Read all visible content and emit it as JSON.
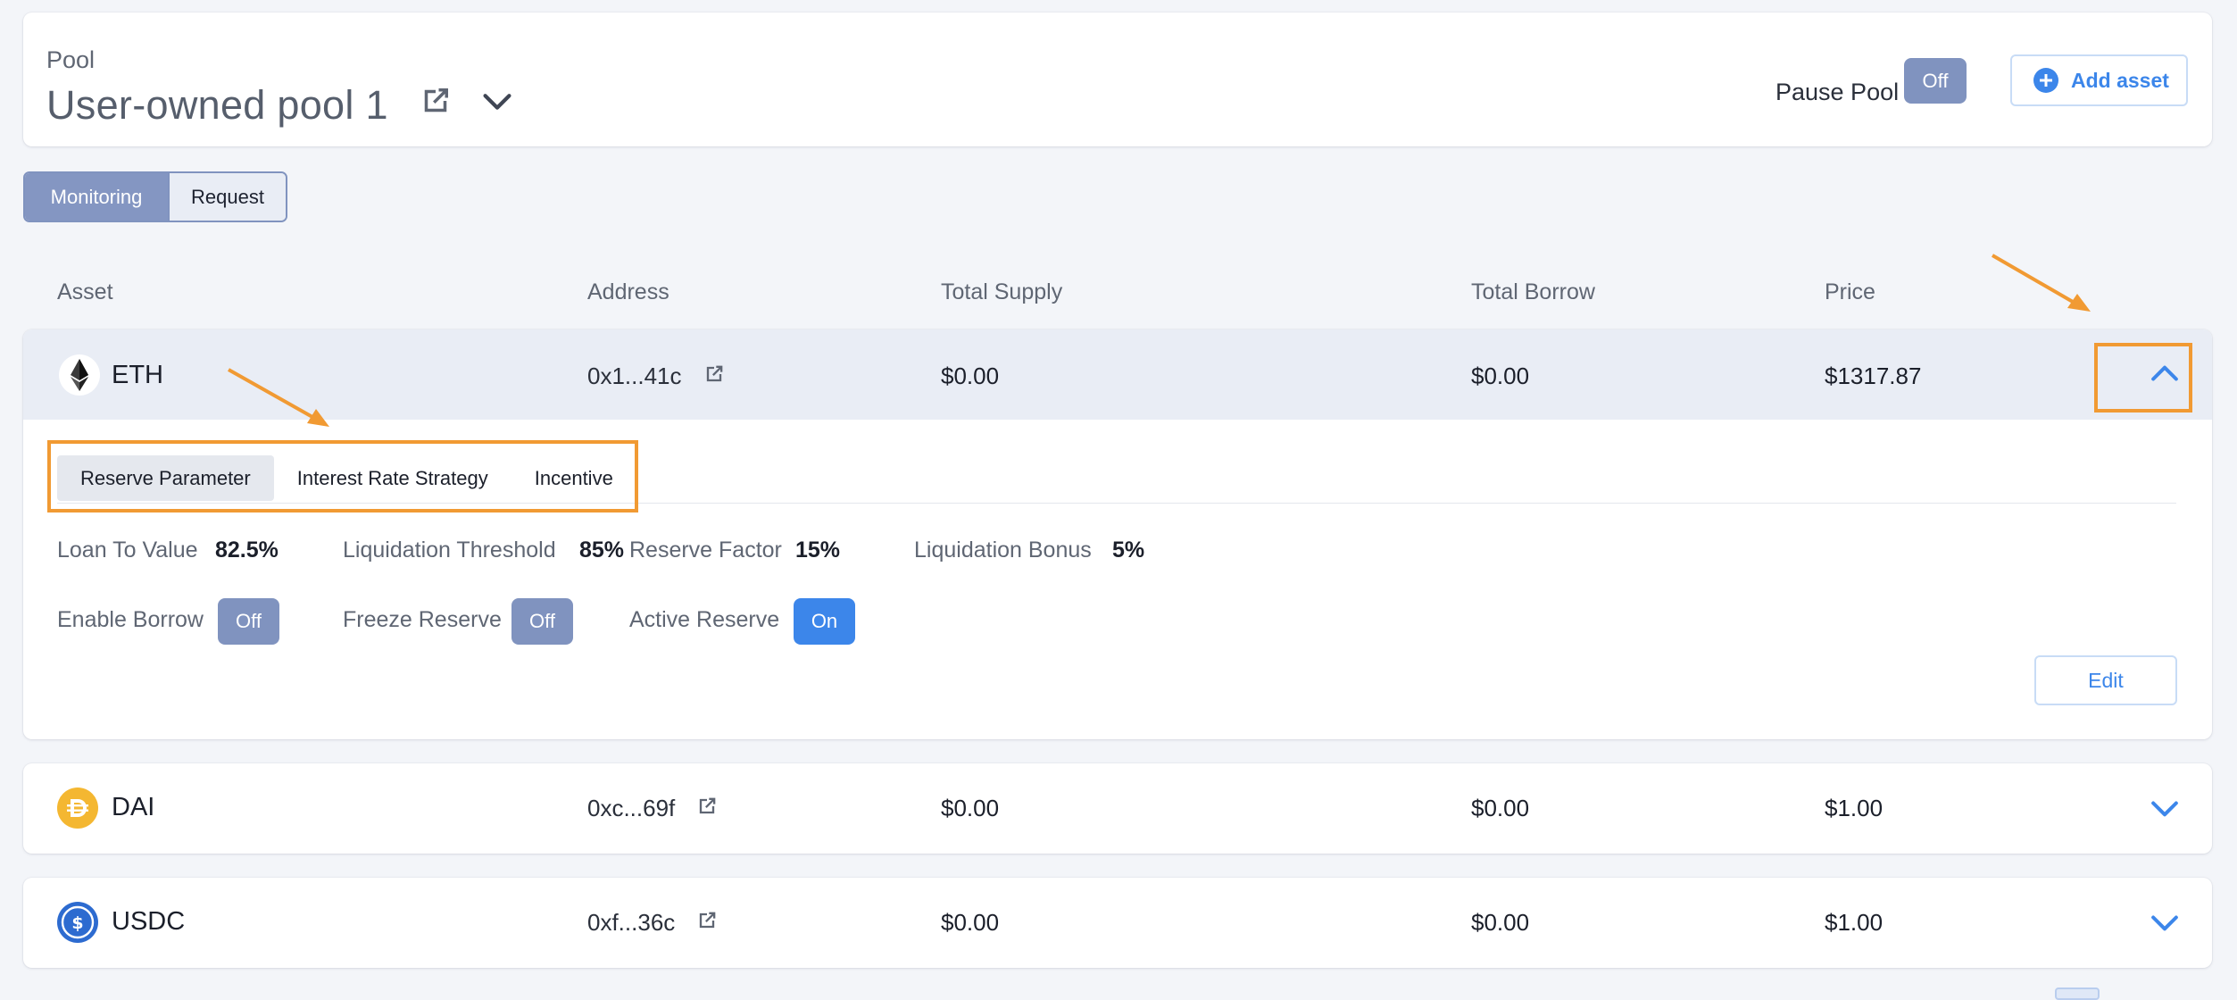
{
  "header": {
    "pool_label": "Pool",
    "pool_title": "User-owned pool 1",
    "pause_label": "Pause Pool",
    "pause_state": "Off",
    "add_asset_label": "Add asset"
  },
  "view_tabs": [
    {
      "label": "Monitoring",
      "active": true
    },
    {
      "label": "Request",
      "active": false
    }
  ],
  "table": {
    "columns": [
      "Asset",
      "Address",
      "Total Supply",
      "Total Borrow",
      "Price"
    ],
    "rows": [
      {
        "symbol": "ETH",
        "icon": "ethereum-icon",
        "address": "0x1...41c",
        "total_supply": "$0.00",
        "total_borrow": "$0.00",
        "price": "$1317.87",
        "expanded": true
      },
      {
        "symbol": "DAI",
        "icon": "dai-icon",
        "address": "0xc...69f",
        "total_supply": "$0.00",
        "total_borrow": "$0.00",
        "price": "$1.00",
        "expanded": false
      },
      {
        "symbol": "USDC",
        "icon": "usdc-icon",
        "address": "0xf...36c",
        "total_supply": "$0.00",
        "total_borrow": "$0.00",
        "price": "$1.00",
        "expanded": false
      }
    ]
  },
  "detail": {
    "tabs": [
      {
        "label": "Reserve Parameter",
        "active": true
      },
      {
        "label": "Interest Rate Strategy",
        "active": false
      },
      {
        "label": "Incentive",
        "active": false
      }
    ],
    "params": {
      "ltv_label": "Loan To Value",
      "ltv_value": "82.5%",
      "liq_threshold_label": "Liquidation Threshold",
      "liq_threshold_value": "85%",
      "reserve_factor_label": "Reserve Factor",
      "reserve_factor_value": "15%",
      "liq_bonus_label": "Liquidation Bonus",
      "liq_bonus_value": "5%"
    },
    "toggles": {
      "enable_borrow_label": "Enable Borrow",
      "enable_borrow_state": "Off",
      "freeze_reserve_label": "Freeze Reserve",
      "freeze_reserve_state": "Off",
      "active_reserve_label": "Active Reserve",
      "active_reserve_state": "On"
    },
    "edit_label": "Edit"
  },
  "colors": {
    "accent_blue": "#3c86ea",
    "toggle_off": "#8093bf",
    "annotation_orange": "#f19a33",
    "row_highlight": "#e9edf5"
  }
}
